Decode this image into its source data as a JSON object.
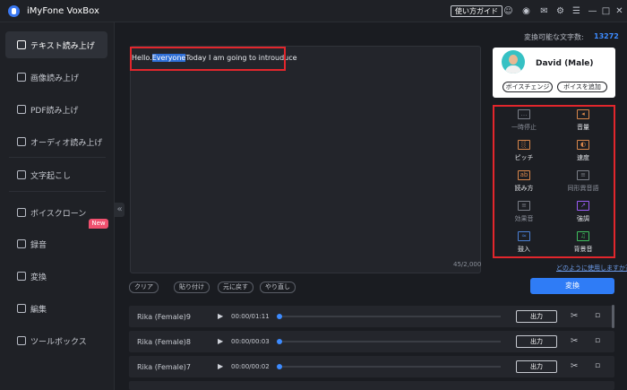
{
  "app": {
    "title": "iMyFone VoxBox",
    "guide_label": "使い方ガイド"
  },
  "titlebar_icons": [
    "user-icon",
    "discord-icon",
    "mail-icon",
    "settings-icon",
    "menu-icon",
    "minimize-icon",
    "maximize-icon",
    "close-icon"
  ],
  "sidebar": {
    "items": [
      {
        "label": "テキスト読み上げ",
        "icon": "text-to-speech-icon",
        "active": true
      },
      {
        "label": "画像読み上げ",
        "icon": "image-icon"
      },
      {
        "label": "PDF読み上げ",
        "icon": "pdf-icon"
      },
      {
        "label": "オーディオ読み上げ",
        "icon": "audio-icon"
      },
      {
        "label": "文字起こし",
        "icon": "transcribe-icon"
      },
      {
        "label": "ボイスクローン",
        "icon": "voice-clone-icon",
        "badge": "New"
      },
      {
        "label": "録音",
        "icon": "microphone-icon"
      },
      {
        "label": "変換",
        "icon": "convert-icon"
      },
      {
        "label": "編集",
        "icon": "edit-icon"
      },
      {
        "label": "ツールボックス",
        "icon": "toolbox-icon"
      }
    ]
  },
  "editor": {
    "text_before": "Hello.",
    "text_selected": "Everyone",
    "text_after": "Today I am going to introuduce",
    "char_count": "45/2,000",
    "buttons": [
      "クリア",
      "貼り付け",
      "元に戻す",
      "やり直し"
    ]
  },
  "chars": {
    "label": "変換可能な文字数:",
    "value": "13272"
  },
  "voice": {
    "name": "David (Male)",
    "change_label": "ボイスチェンジ",
    "add_label": "ボイスを追加"
  },
  "effects": [
    {
      "label": "一時停止",
      "icon": "pause-icon"
    },
    {
      "label": "音量",
      "icon": "volume-icon"
    },
    {
      "label": "ピッチ",
      "icon": "pitch-icon"
    },
    {
      "label": "速度",
      "icon": "speed-icon"
    },
    {
      "label": "読み方",
      "icon": "pronunciation-icon"
    },
    {
      "label": "同形異音語",
      "icon": "homograph-icon"
    },
    {
      "label": "効果音",
      "icon": "sound-effect-icon"
    },
    {
      "label": "強調",
      "icon": "emphasis-icon"
    },
    {
      "label": "鼓入",
      "icon": "breath-icon"
    },
    {
      "label": "背景音",
      "icon": "background-music-icon"
    }
  ],
  "howto_label": "どのように使用しますか？",
  "convert_label": "変換",
  "history": [
    {
      "name": "Rika (Female)9",
      "time": "00:00/01:11",
      "output": "出力"
    },
    {
      "name": "Rika (Female)8",
      "time": "00:00/00:03",
      "output": "出力"
    },
    {
      "name": "Rika (Female)7",
      "time": "00:00/00:02",
      "output": "出力"
    }
  ],
  "colors": {
    "accent": "#2f7cf6",
    "highlight_border": "#e2262c",
    "badge": "#f0506e"
  }
}
